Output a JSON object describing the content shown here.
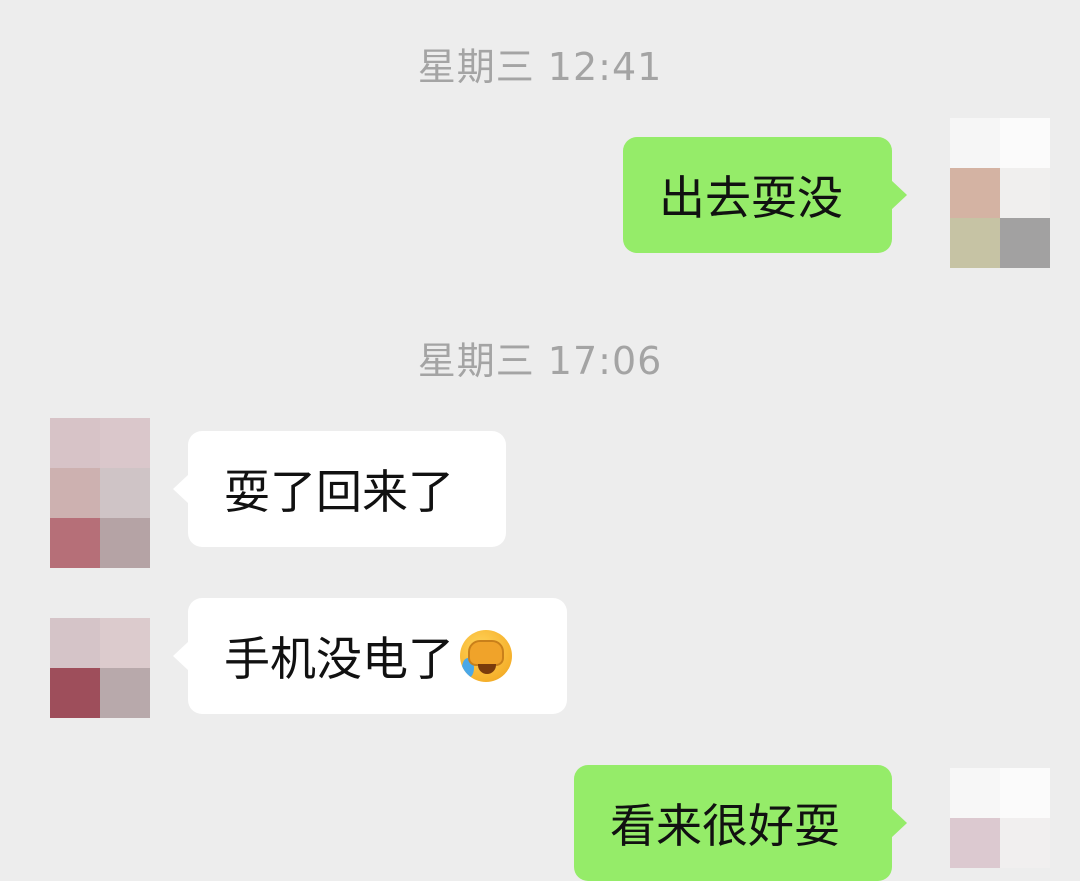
{
  "messages": [
    {
      "type": "timestamp",
      "text": "星期三 12:41"
    },
    {
      "type": "sent",
      "text": "出去耍没"
    },
    {
      "type": "timestamp",
      "text": "星期三 17:06"
    },
    {
      "type": "received",
      "text": "耍了回来了"
    },
    {
      "type": "received",
      "text": "手机没电了",
      "emoji": "facepalm-crying-emoji"
    },
    {
      "type": "sent",
      "text": "看来很好耍"
    }
  ],
  "colors": {
    "background": "#ededed",
    "sent_bubble": "#95ec69",
    "received_bubble": "#ffffff",
    "timestamp_text": "#a4a4a4",
    "message_text": "#111111"
  }
}
